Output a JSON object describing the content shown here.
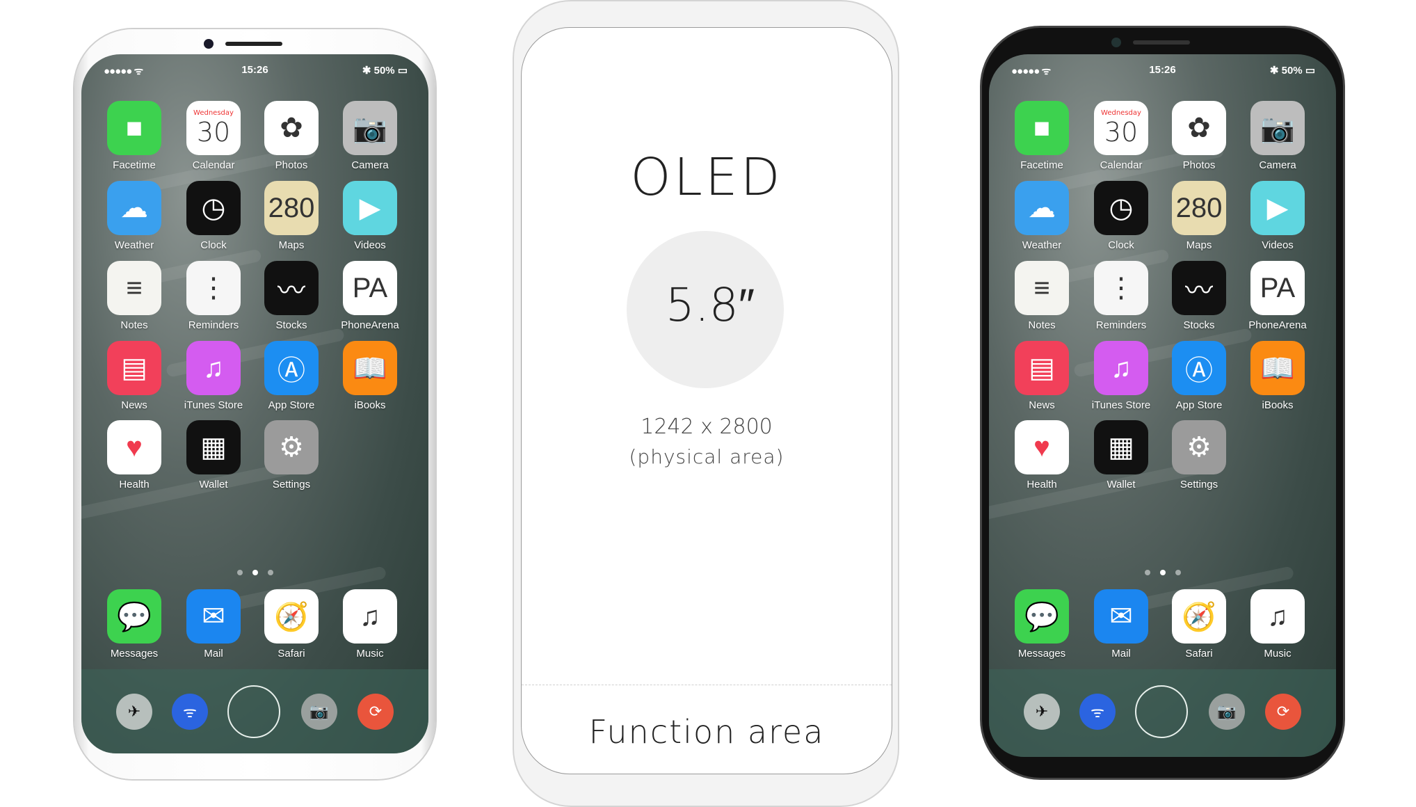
{
  "status_bar": {
    "signal": "●●●●● ᯤ",
    "time": "15:26",
    "battery": "✱ 50% ▭"
  },
  "apps": [
    {
      "label": "Facetime",
      "icon": "video-camera-icon",
      "color": "#3dd24f",
      "glyph": "■"
    },
    {
      "label": "Calendar",
      "icon": "calendar-icon",
      "color": "#ffffff",
      "glyph": "30",
      "sub": "Wednesday"
    },
    {
      "label": "Photos",
      "icon": "photos-flower-icon",
      "color": "#ffffff",
      "glyph": "✿"
    },
    {
      "label": "Camera",
      "icon": "camera-icon",
      "color": "#bdbdbd",
      "glyph": "📷"
    },
    {
      "label": "Weather",
      "icon": "weather-cloud-icon",
      "color": "#3aa0ee",
      "glyph": "☁"
    },
    {
      "label": "Clock",
      "icon": "clock-icon",
      "color": "#111111",
      "glyph": "◷"
    },
    {
      "label": "Maps",
      "icon": "maps-icon",
      "color": "#e8dcb0",
      "glyph": "280"
    },
    {
      "label": "Videos",
      "icon": "clapperboard-icon",
      "color": "#5fd6e0",
      "glyph": "▶"
    },
    {
      "label": "Notes",
      "icon": "notes-icon",
      "color": "#f4f4f0",
      "glyph": "≡"
    },
    {
      "label": "Reminders",
      "icon": "reminders-icon",
      "color": "#f6f6f6",
      "glyph": "⋮"
    },
    {
      "label": "Stocks",
      "icon": "stocks-chart-icon",
      "color": "#111111",
      "glyph": "〰"
    },
    {
      "label": "PhoneArena",
      "icon": "phonearena-logo-icon",
      "color": "#ffffff",
      "glyph": "PA"
    },
    {
      "label": "News",
      "icon": "news-icon",
      "color": "#f2405a",
      "glyph": "▤"
    },
    {
      "label": "iTunes Store",
      "icon": "music-note-icon",
      "color": "#d45cf0",
      "glyph": "♫"
    },
    {
      "label": "App Store",
      "icon": "app-store-icon",
      "color": "#1c8ef2",
      "glyph": "Ⓐ"
    },
    {
      "label": "iBooks",
      "icon": "book-icon",
      "color": "#fb8a12",
      "glyph": "📖"
    },
    {
      "label": "Health",
      "icon": "heart-icon",
      "color": "#ffffff",
      "glyph": "♥"
    },
    {
      "label": "Wallet",
      "icon": "wallet-icon",
      "color": "#111111",
      "glyph": "▦"
    },
    {
      "label": "Settings",
      "icon": "gear-icon",
      "color": "#9b9b9b",
      "glyph": "⚙"
    }
  ],
  "dock": [
    {
      "label": "Messages",
      "icon": "message-bubble-icon",
      "color": "#3dd24f",
      "glyph": "💬"
    },
    {
      "label": "Mail",
      "icon": "envelope-icon",
      "color": "#1b86f0",
      "glyph": "✉"
    },
    {
      "label": "Safari",
      "icon": "compass-icon",
      "color": "#ffffff",
      "glyph": "🧭"
    },
    {
      "label": "Music",
      "icon": "music-icon",
      "color": "#ffffff",
      "glyph": "♫"
    }
  ],
  "page_dots": {
    "count": 3,
    "active": 1
  },
  "function_controls": [
    {
      "icon": "airplane-icon",
      "color": "#b7bfbc",
      "glyph": "✈"
    },
    {
      "icon": "wifi-icon",
      "color": "#2b64e0",
      "glyph": "ᯤ"
    },
    {
      "icon": "home-button-icon"
    },
    {
      "icon": "camera-icon",
      "color": "#9aa09e",
      "glyph": "📷"
    },
    {
      "icon": "rotation-lock-icon",
      "color": "#e9553c",
      "glyph": "⟳"
    }
  ],
  "diagram": {
    "title": "OLED",
    "size": "5.8″",
    "resolution": "1242 x 2800",
    "resolution_note": "(physical area)",
    "function_area": "Function area"
  }
}
